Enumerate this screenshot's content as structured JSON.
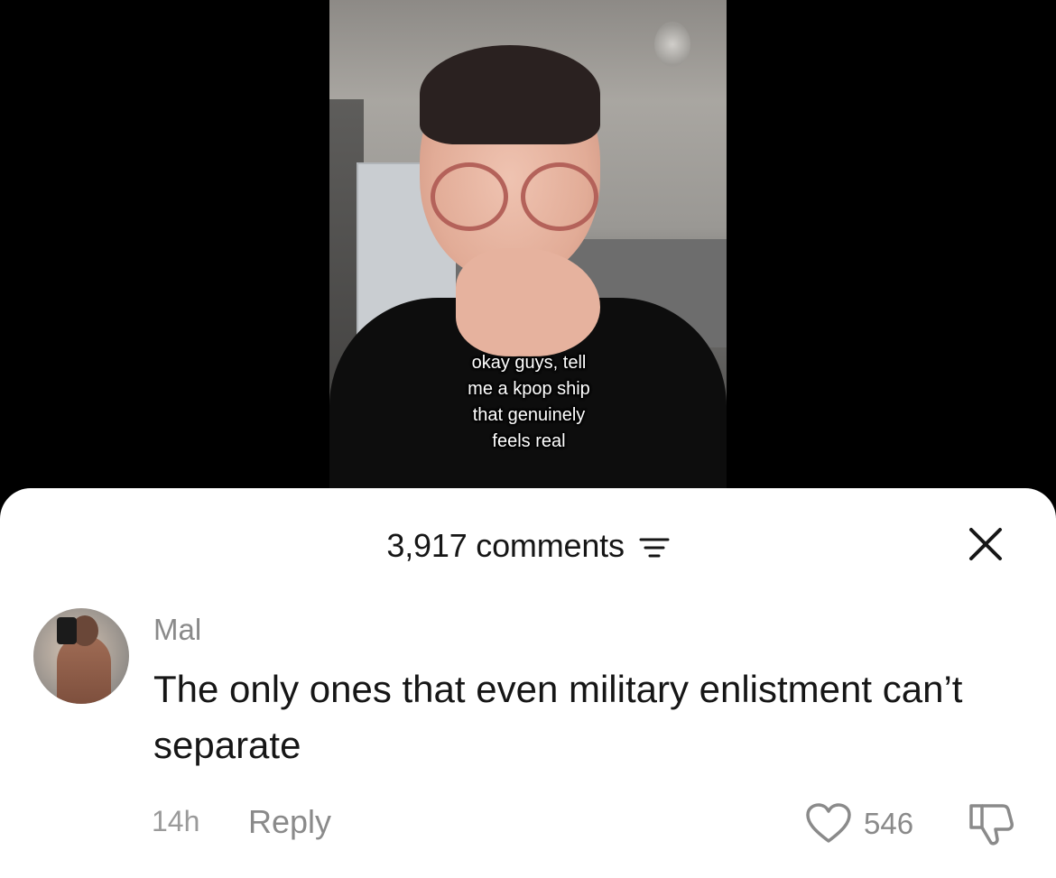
{
  "video": {
    "caption_lines": [
      "okay guys, tell",
      "me a kpop ship",
      "that genuinely",
      "feels real"
    ]
  },
  "comments_header": {
    "count_label": "3,917 comments",
    "filter_icon": "filter-icon",
    "close_icon": "close-icon"
  },
  "comment": {
    "username": "Mal",
    "text": "The only ones that even military enlistment can’t separate",
    "time": "14h",
    "reply_label": "Reply",
    "like_count": "546",
    "like_icon": "heart-icon",
    "dislike_icon": "thumbs-down-icon"
  },
  "colors": {
    "sheet_bg": "#ffffff",
    "text_primary": "#161616",
    "text_muted": "#8a8a8a",
    "backdrop": "#000000"
  }
}
